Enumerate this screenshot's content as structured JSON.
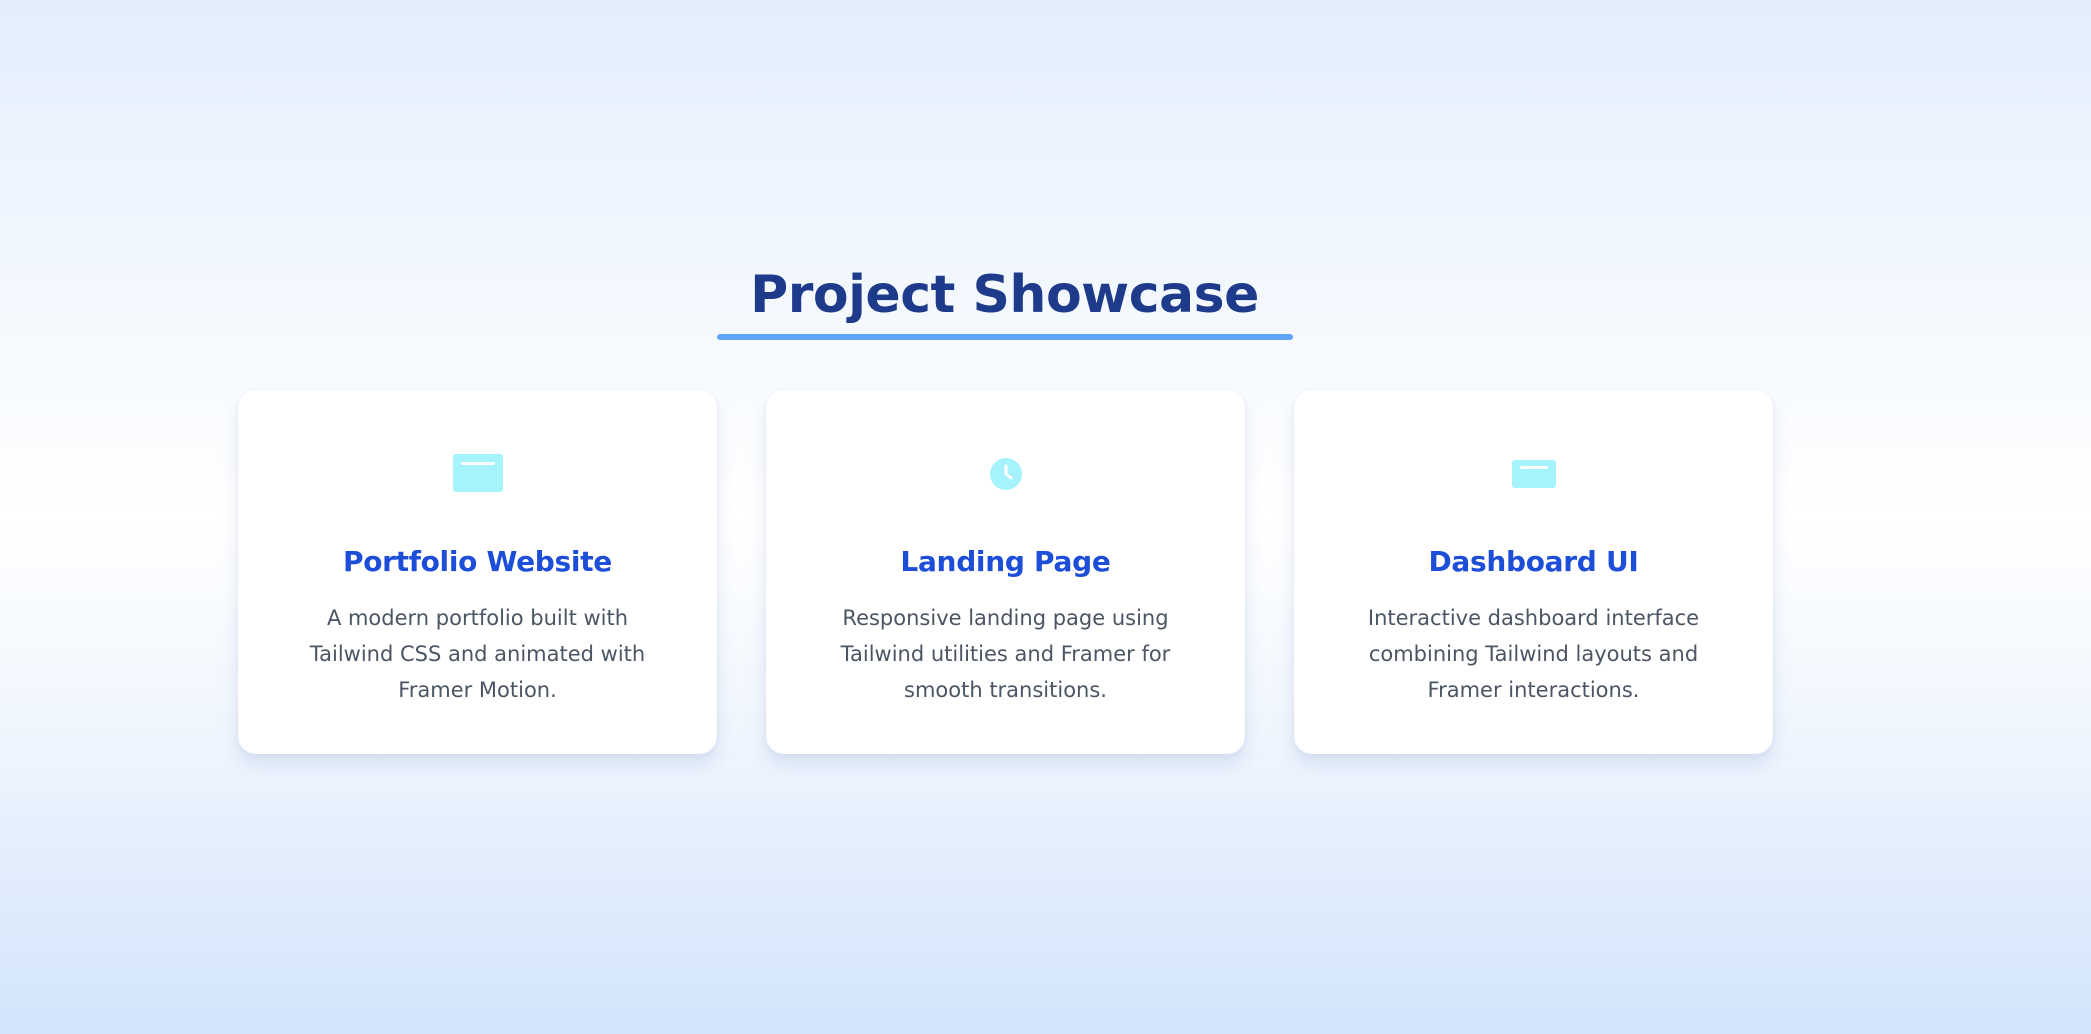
{
  "header": {
    "title": "Project Showcase"
  },
  "projects": [
    {
      "icon": "browser-window-icon",
      "title": "Portfolio Website",
      "description": "A modern portfolio built with Tailwind CSS and animated with Framer Motion."
    },
    {
      "icon": "clock-icon",
      "title": "Landing Page",
      "description": "Responsive landing page using Tailwind utilities and Framer for smooth transitions."
    },
    {
      "icon": "dashboard-panel-icon",
      "title": "Dashboard UI",
      "description": "Interactive dashboard interface combining Tailwind layouts and Framer interactions."
    }
  ],
  "colors": {
    "title": "#1e3a8a",
    "underline": "#60a5fa",
    "card_title": "#1d4ed8",
    "card_text": "#4b5563",
    "icon": "#a5f3fc",
    "icon_detail": "#ffffff"
  }
}
